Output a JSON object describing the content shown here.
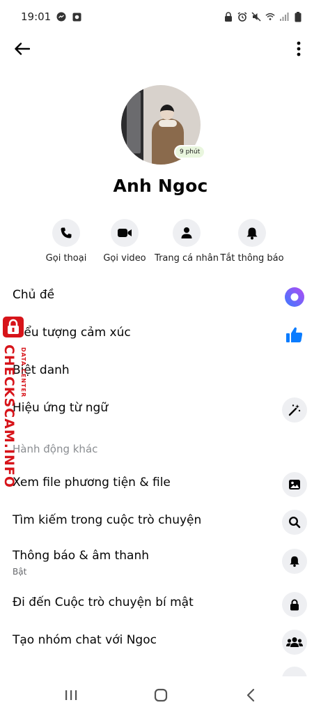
{
  "status": {
    "time": "19:01"
  },
  "contact": {
    "name": "Anh Ngoc",
    "active_badge": "9 phút"
  },
  "actions": [
    {
      "label": "Gọi thoại",
      "icon": "phone-icon"
    },
    {
      "label": "Gọi video",
      "icon": "video-camera-icon"
    },
    {
      "label": "Trang cá nhân",
      "icon": "person-icon"
    },
    {
      "label": "Tắt thông báo",
      "icon": "bell-icon"
    }
  ],
  "customize": {
    "theme": "Chủ đề",
    "emoji": "Biểu tượng cảm xúc",
    "nicknames": "Biệt danh",
    "word_effects": "Hiệu ứng từ ngữ"
  },
  "more_actions": {
    "section_label": "Hành động khác",
    "view_media": "Xem file phương tiện & file",
    "search": "Tìm kiếm trong cuộc trò chuyện",
    "notifications": "Thông báo & âm thanh",
    "notifications_status": "Bật",
    "secret_chat": "Đi đến Cuộc trò chuyện bí mật",
    "create_group": "Tạo nhóm chat với Ngoc"
  },
  "watermark": {
    "text": "CHECKSCAM.INFO",
    "subtext": "DATA CENTER"
  },
  "colors": {
    "accent": "#0a7cff",
    "theme_gradient": [
      "#3a7bff",
      "#b24bf3"
    ],
    "watermark": "#d7141a"
  }
}
